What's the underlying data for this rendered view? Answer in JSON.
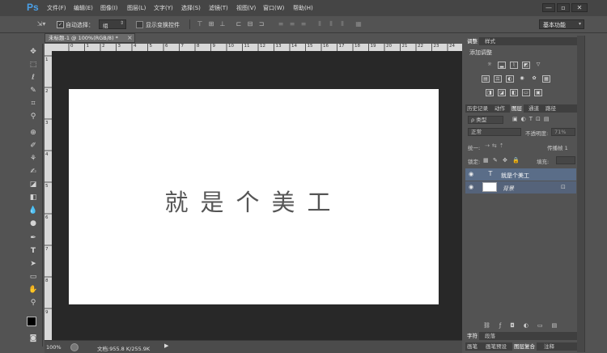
{
  "app": {
    "logo": "Ps",
    "accent": "#4aa0e8"
  },
  "menu": [
    "文件(F)",
    "编辑(E)",
    "图像(I)",
    "图层(L)",
    "文字(Y)",
    "选择(S)",
    "滤镜(T)",
    "视图(V)",
    "窗口(W)",
    "帮助(H)"
  ],
  "window_controls": {
    "minimize": "—",
    "restore": "▫",
    "close": "✕"
  },
  "options": {
    "auto_select_label": "自动选择：",
    "auto_select_value": "组",
    "show_transform_label": "显示变换控件",
    "workspace": "基本功能"
  },
  "document": {
    "tab_title": "未标题-1 @ 100%(RGB/8) *",
    "close": "×"
  },
  "canvas": {
    "text": "就是个美工",
    "background": "#ffffff",
    "text_color": "#555555"
  },
  "ruler": {
    "top_labels": [
      "0",
      "1",
      "2",
      "3",
      "4",
      "5",
      "6",
      "7",
      "8",
      "9",
      "10",
      "11",
      "12",
      "13",
      "14",
      "15",
      "16",
      "17",
      "18",
      "19",
      "20",
      "21",
      "22",
      "23",
      "24",
      "25"
    ],
    "left_labels": [
      "1",
      "2",
      "3",
      "4",
      "5",
      "6",
      "7",
      "8",
      "9"
    ]
  },
  "status": {
    "zoom": "100%",
    "doc_info": "文档:955.8 K/255.9K"
  },
  "tools": [
    "move-icon",
    "marquee-icon",
    "lasso-icon",
    "quick-select-icon",
    "crop-icon",
    "eyedropper-icon",
    "healing-icon",
    "brush-icon",
    "stamp-icon",
    "history-brush-icon",
    "eraser-icon",
    "gradient-icon",
    "blur-icon",
    "dodge-icon",
    "pen-icon",
    "type-icon",
    "path-select-icon",
    "shape-icon",
    "hand-icon",
    "zoom-icon"
  ],
  "panels": {
    "adjust_tabs": [
      "调整",
      "样式"
    ],
    "adjust_title": "添加调整",
    "layer_tabs": [
      "历史记录",
      "动作",
      "图层",
      "通道",
      "路径"
    ],
    "filter_kind": "ρ 类型",
    "blend_mode": "正常",
    "opacity_label": "不透明度:",
    "opacity_value": "71%",
    "unify_label": "统一:",
    "propagate_label": "传播帧 1",
    "lock_label": "锁定:",
    "fill_label": "填充:",
    "layers": [
      {
        "name": "就是个美工",
        "type_glyph": "T",
        "selected": true
      },
      {
        "name": "背景",
        "selected": false
      }
    ],
    "bottom_tabs_1": [
      "字符",
      "段落"
    ],
    "bottom_tabs_2": [
      "画笔",
      "画笔预设",
      "图层复合",
      "注释"
    ]
  }
}
